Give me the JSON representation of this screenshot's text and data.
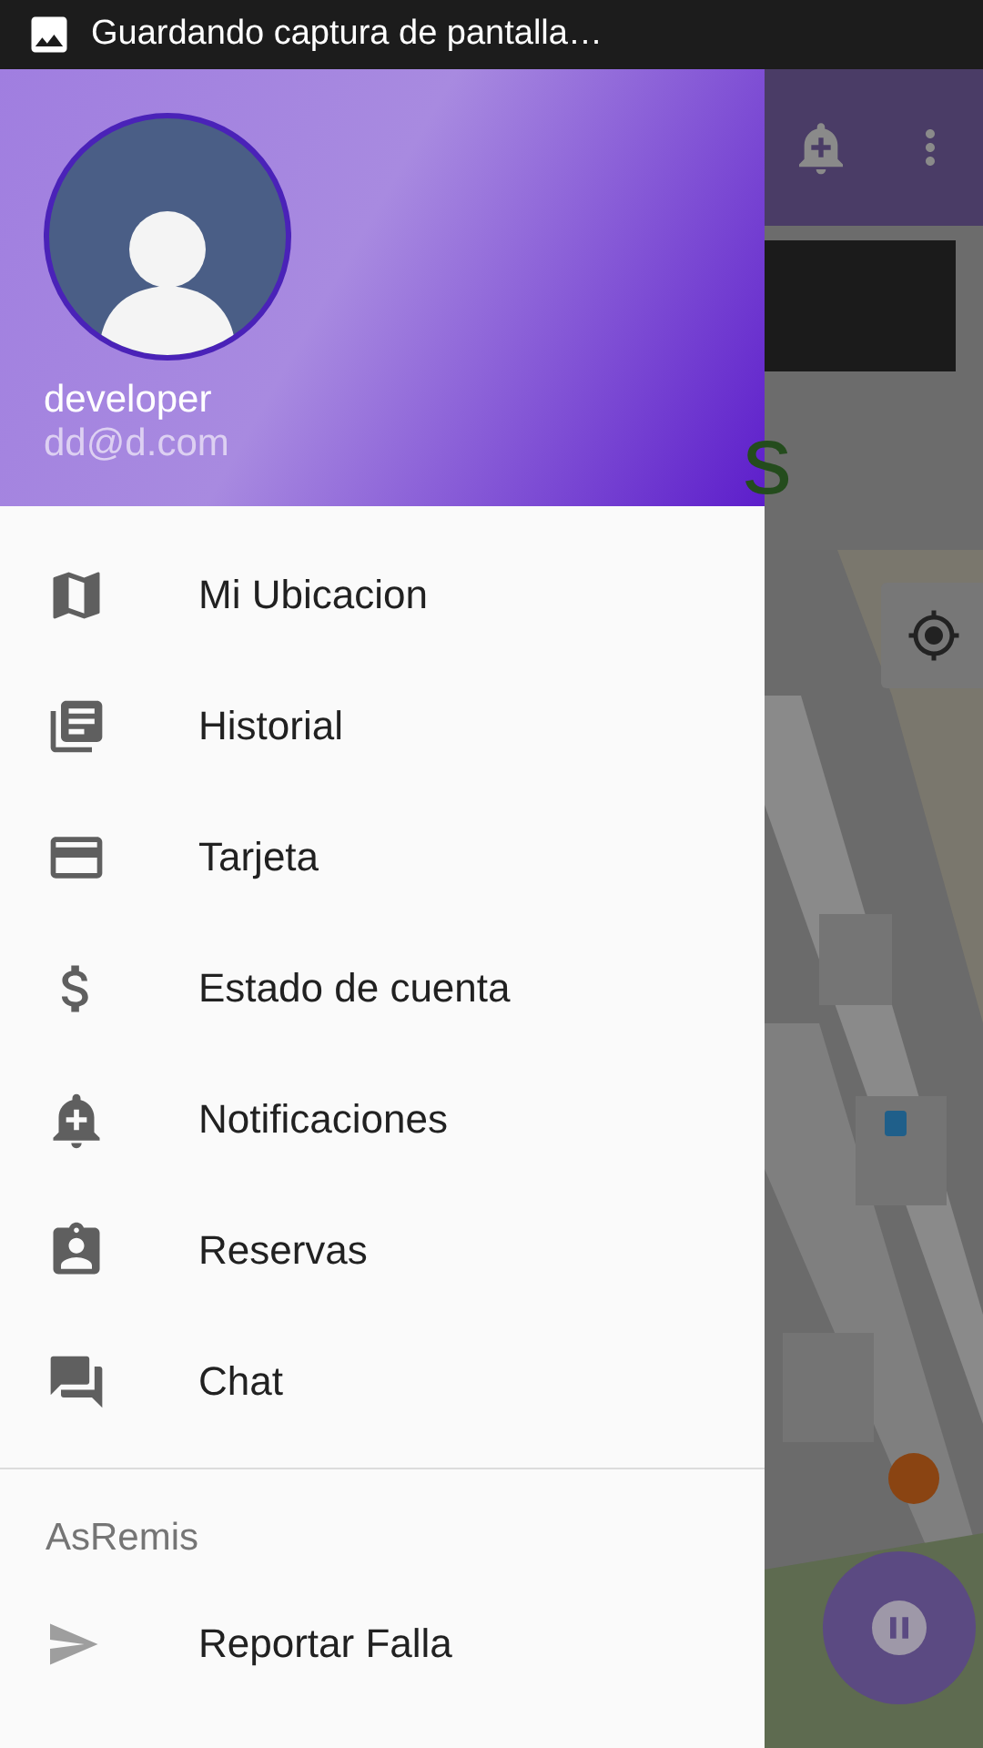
{
  "status_bar": {
    "notification": "Guardando captura de pantalla…"
  },
  "drawer": {
    "header": {
      "name": "developer",
      "email": "dd@d.com"
    },
    "items": [
      {
        "label": "Mi Ubicacion"
      },
      {
        "label": "Historial"
      },
      {
        "label": "Tarjeta"
      },
      {
        "label": "Estado de cuenta"
      },
      {
        "label": "Notificaciones"
      },
      {
        "label": "Reservas"
      },
      {
        "label": "Chat"
      }
    ],
    "section": {
      "title": "AsRemis",
      "items": [
        {
          "label": "Reportar Falla"
        }
      ]
    }
  },
  "background": {
    "title_fragment": "s"
  }
}
